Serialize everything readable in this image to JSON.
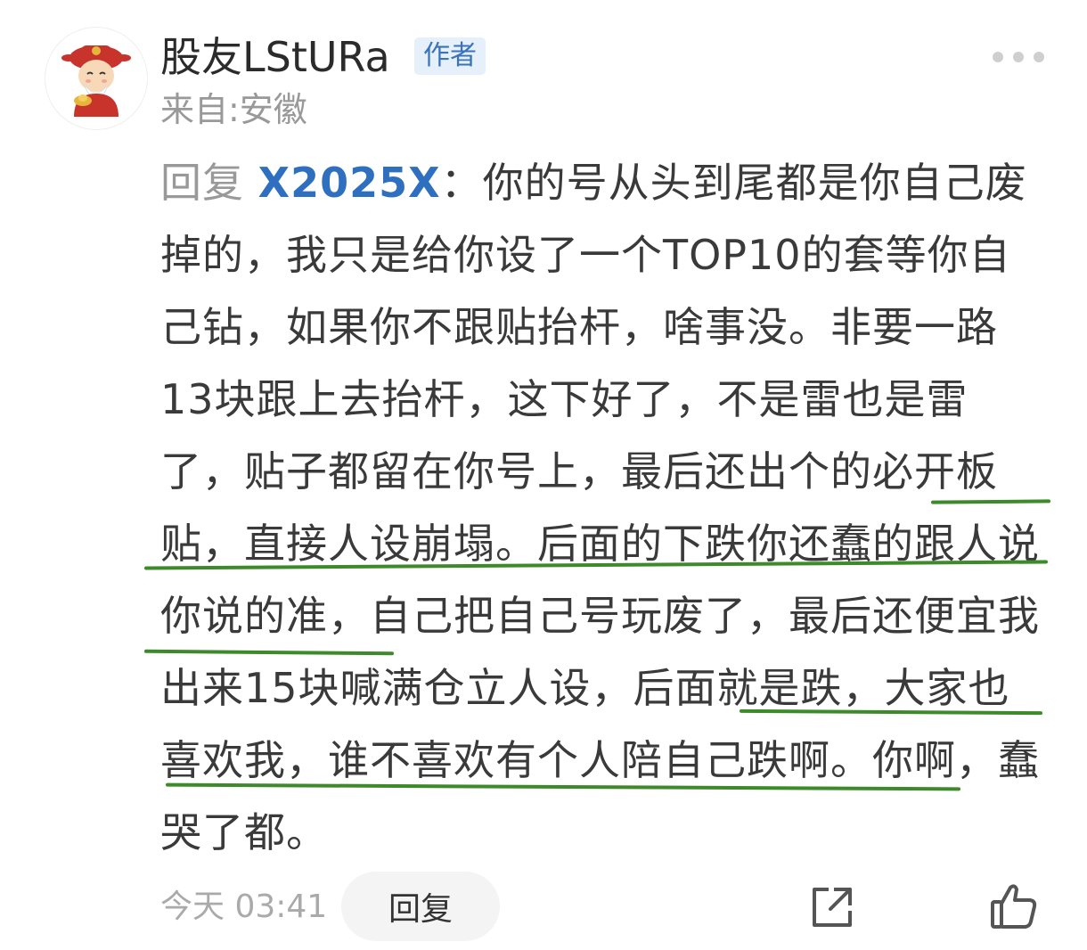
{
  "comment": {
    "username": "股友LStURa",
    "author_badge": "作者",
    "location": "来自:安徽",
    "reply_prefix": "回复",
    "mention": "X2025X",
    "separator": "：",
    "body_part1": "你的号从头到尾都是你自己废掉的，我只是给你设了一个TOP10的套等你自己钻，如果你不跟贴抬杆，啥事没。非要一路13块跟上去抬杆，这下好了，不是雷也是雷了，贴子都留在你号上，最后还出个的",
    "body_part2": "必开板贴，直接人设崩塌。后面的下跌你还蠢的跟人说你说的准",
    "body_part3": "，自己把自己号玩废了，最后还便宜我出来15块喊满仓立人设，",
    "body_part4": "后面就是跌，大家也喜欢我，谁不喜欢有个人陪自己跌啊",
    "body_part5": "。你啊，蠢哭了都。",
    "timestamp": "今天 03:41",
    "reply_button": "回复"
  },
  "icons": {
    "avatar": "god-of-wealth-avatar",
    "more": "more-dots-icon",
    "share": "share-icon",
    "like": "thumbs-up-icon"
  },
  "colors": {
    "mention": "#2e6fc0",
    "badge_bg": "#e6f0fb",
    "badge_text": "#3a73b8",
    "muted": "#999999",
    "underline_marks": "#3d8a2a"
  }
}
